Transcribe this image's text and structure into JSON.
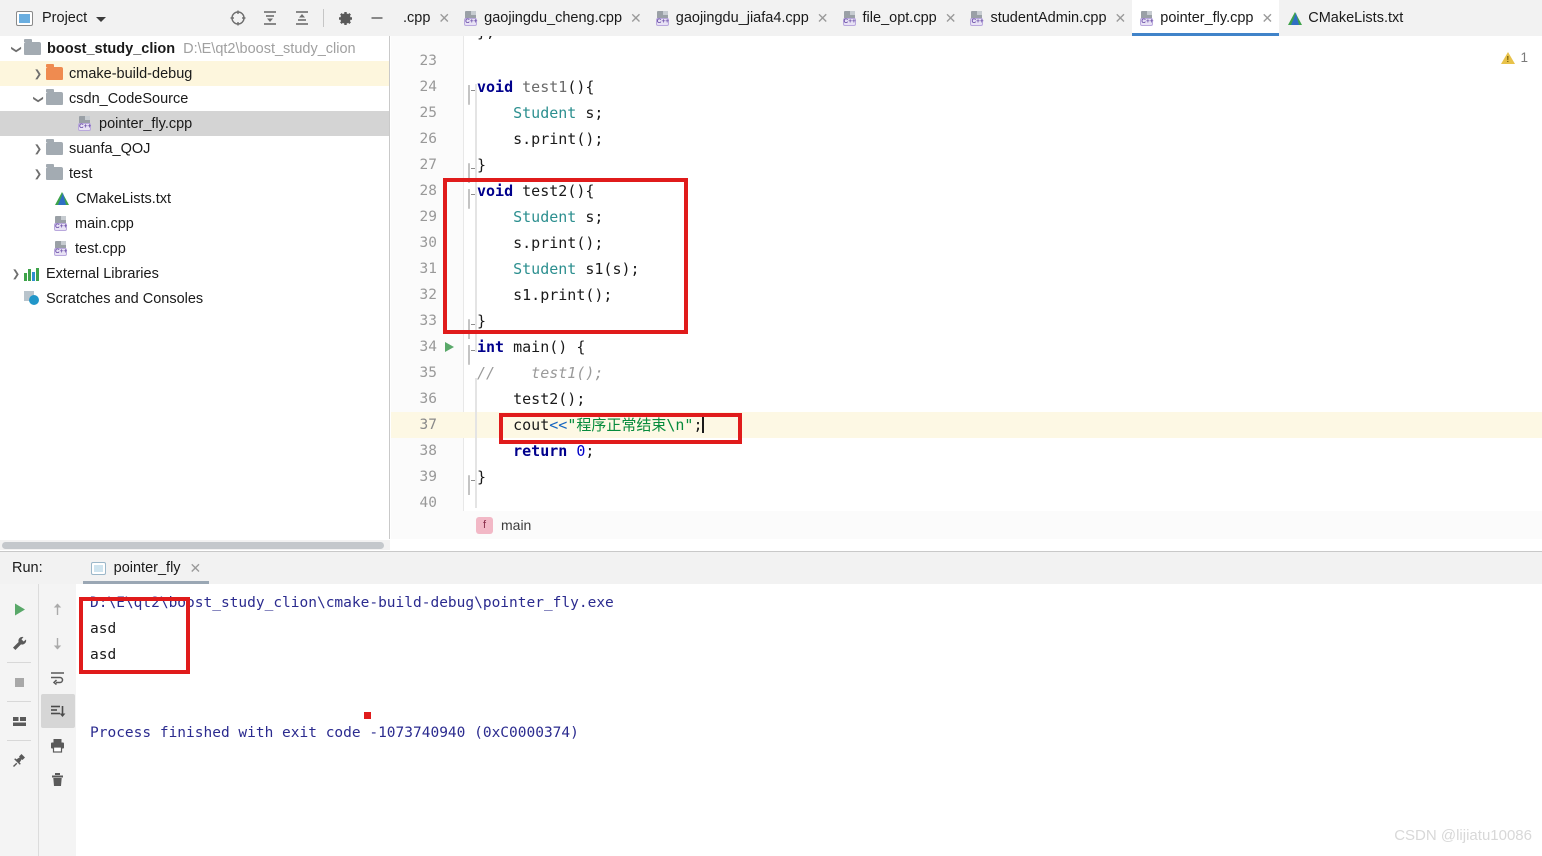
{
  "window": {
    "panel_title": "Project",
    "warning_count": "1"
  },
  "project_toolbar": {
    "icons": [
      "locate-icon",
      "expand-all-icon",
      "collapse-all-icon",
      "gear-icon",
      "minimize-icon"
    ]
  },
  "tree": {
    "items": [
      {
        "label": "boost_study_clion",
        "path": "D:\\E\\qt2\\boost_study_clion",
        "indent": 0,
        "arrow": "down",
        "icon": "folder-icon",
        "state": "normal"
      },
      {
        "label": "cmake-build-debug",
        "path": "",
        "indent": 1,
        "arrow": "right",
        "icon": "folder-orange-icon",
        "state": "highlight"
      },
      {
        "label": "csdn_CodeSource",
        "path": "",
        "indent": 1,
        "arrow": "down",
        "icon": "folder-icon",
        "state": "normal"
      },
      {
        "label": "pointer_fly.cpp",
        "path": "",
        "indent": 2,
        "arrow": "none",
        "icon": "cpp-file-icon",
        "state": "selected"
      },
      {
        "label": "suanfa_QOJ",
        "path": "",
        "indent": 1,
        "arrow": "right",
        "icon": "folder-icon",
        "state": "normal"
      },
      {
        "label": "test",
        "path": "",
        "indent": 1,
        "arrow": "right",
        "icon": "folder-icon",
        "state": "normal"
      },
      {
        "label": "CMakeLists.txt",
        "path": "",
        "indent": 1,
        "arrow": "none",
        "icon": "cmake-file-icon",
        "state": "normal"
      },
      {
        "label": "main.cpp",
        "path": "",
        "indent": 1,
        "arrow": "none",
        "icon": "cpp-file-icon",
        "state": "normal"
      },
      {
        "label": "test.cpp",
        "path": "",
        "indent": 1,
        "arrow": "none",
        "icon": "cpp-file-icon",
        "state": "normal"
      },
      {
        "label": "External Libraries",
        "path": "",
        "indent": 0,
        "arrow": "right",
        "icon": "libraries-icon",
        "state": "normal"
      },
      {
        "label": "Scratches and Consoles",
        "path": "",
        "indent": 0,
        "arrow": "none",
        "icon": "scratches-icon",
        "state": "normal"
      }
    ]
  },
  "tabs": [
    {
      "label": ".cpp",
      "icon": "cpp-file-icon",
      "active": false,
      "closable": true,
      "truncated": true
    },
    {
      "label": "gaojingdu_cheng.cpp",
      "icon": "cpp-file-icon",
      "active": false,
      "closable": true
    },
    {
      "label": "gaojingdu_jiafa4.cpp",
      "icon": "cpp-file-icon",
      "active": false,
      "closable": true
    },
    {
      "label": "file_opt.cpp",
      "icon": "cpp-file-icon",
      "active": false,
      "closable": true
    },
    {
      "label": "studentAdmin.cpp",
      "icon": "cpp-file-icon",
      "active": false,
      "closable": true
    },
    {
      "label": "pointer_fly.cpp",
      "icon": "cpp-file-icon",
      "active": true,
      "closable": true
    },
    {
      "label": "CMakeLists.txt",
      "icon": "cmake-file-icon",
      "active": false,
      "closable": false
    }
  ],
  "editor": {
    "lines": [
      {
        "num": "23",
        "text": ""
      },
      {
        "num": "24",
        "text": "void test1(){"
      },
      {
        "num": "25",
        "text": "    Student s;"
      },
      {
        "num": "26",
        "text": "    s.print();"
      },
      {
        "num": "27",
        "text": "}"
      },
      {
        "num": "28",
        "text": "void test2(){"
      },
      {
        "num": "29",
        "text": "    Student s;"
      },
      {
        "num": "30",
        "text": "    s.print();"
      },
      {
        "num": "31",
        "text": "    Student s1(s);"
      },
      {
        "num": "32",
        "text": "    s1.print();"
      },
      {
        "num": "33",
        "text": "}"
      },
      {
        "num": "34",
        "text": "int main() {"
      },
      {
        "num": "35",
        "text": "//    test1();"
      },
      {
        "num": "36",
        "text": "    test2();"
      },
      {
        "num": "37",
        "text": "    cout<<\"程序正常结束\\n\";"
      },
      {
        "num": "38",
        "text": "    return 0;"
      },
      {
        "num": "39",
        "text": "}"
      },
      {
        "num": "40",
        "text": ""
      }
    ],
    "highlighted_line": "37",
    "breadcrumb": {
      "kind": "f",
      "label": "main"
    }
  },
  "run": {
    "label": "Run:",
    "tab_label": "pointer_fly",
    "left_tools": [
      "rerun-icon",
      "wrench-icon",
      "stop-icon",
      "layout-icon",
      "pin-icon"
    ],
    "right_tools": [
      "up-arrow-icon",
      "down-arrow-icon",
      "soft-wrap-icon",
      "scroll-to-end-icon",
      "print-icon",
      "trash-icon"
    ],
    "console_lines": [
      {
        "text": "D:\\E\\qt2\\boost_study_clion\\cmake-build-debug\\pointer_fly.exe",
        "style": "path"
      },
      {
        "text": "asd",
        "style": "out"
      },
      {
        "text": "asd",
        "style": "out"
      },
      {
        "text": "Process finished with exit code -1073740940 (0xC0000374)",
        "style": "fin"
      }
    ]
  },
  "watermark": "CSDN @lijiatu10086",
  "colors": {
    "accent": "#4083c9",
    "keyword": "#00008c",
    "type": "#2c8f8f",
    "string": "#068b3c",
    "comment": "#9a9a9a",
    "annotation_box": "#e01b1b",
    "warning": "#e8c24a",
    "run_green": "#59a869"
  }
}
